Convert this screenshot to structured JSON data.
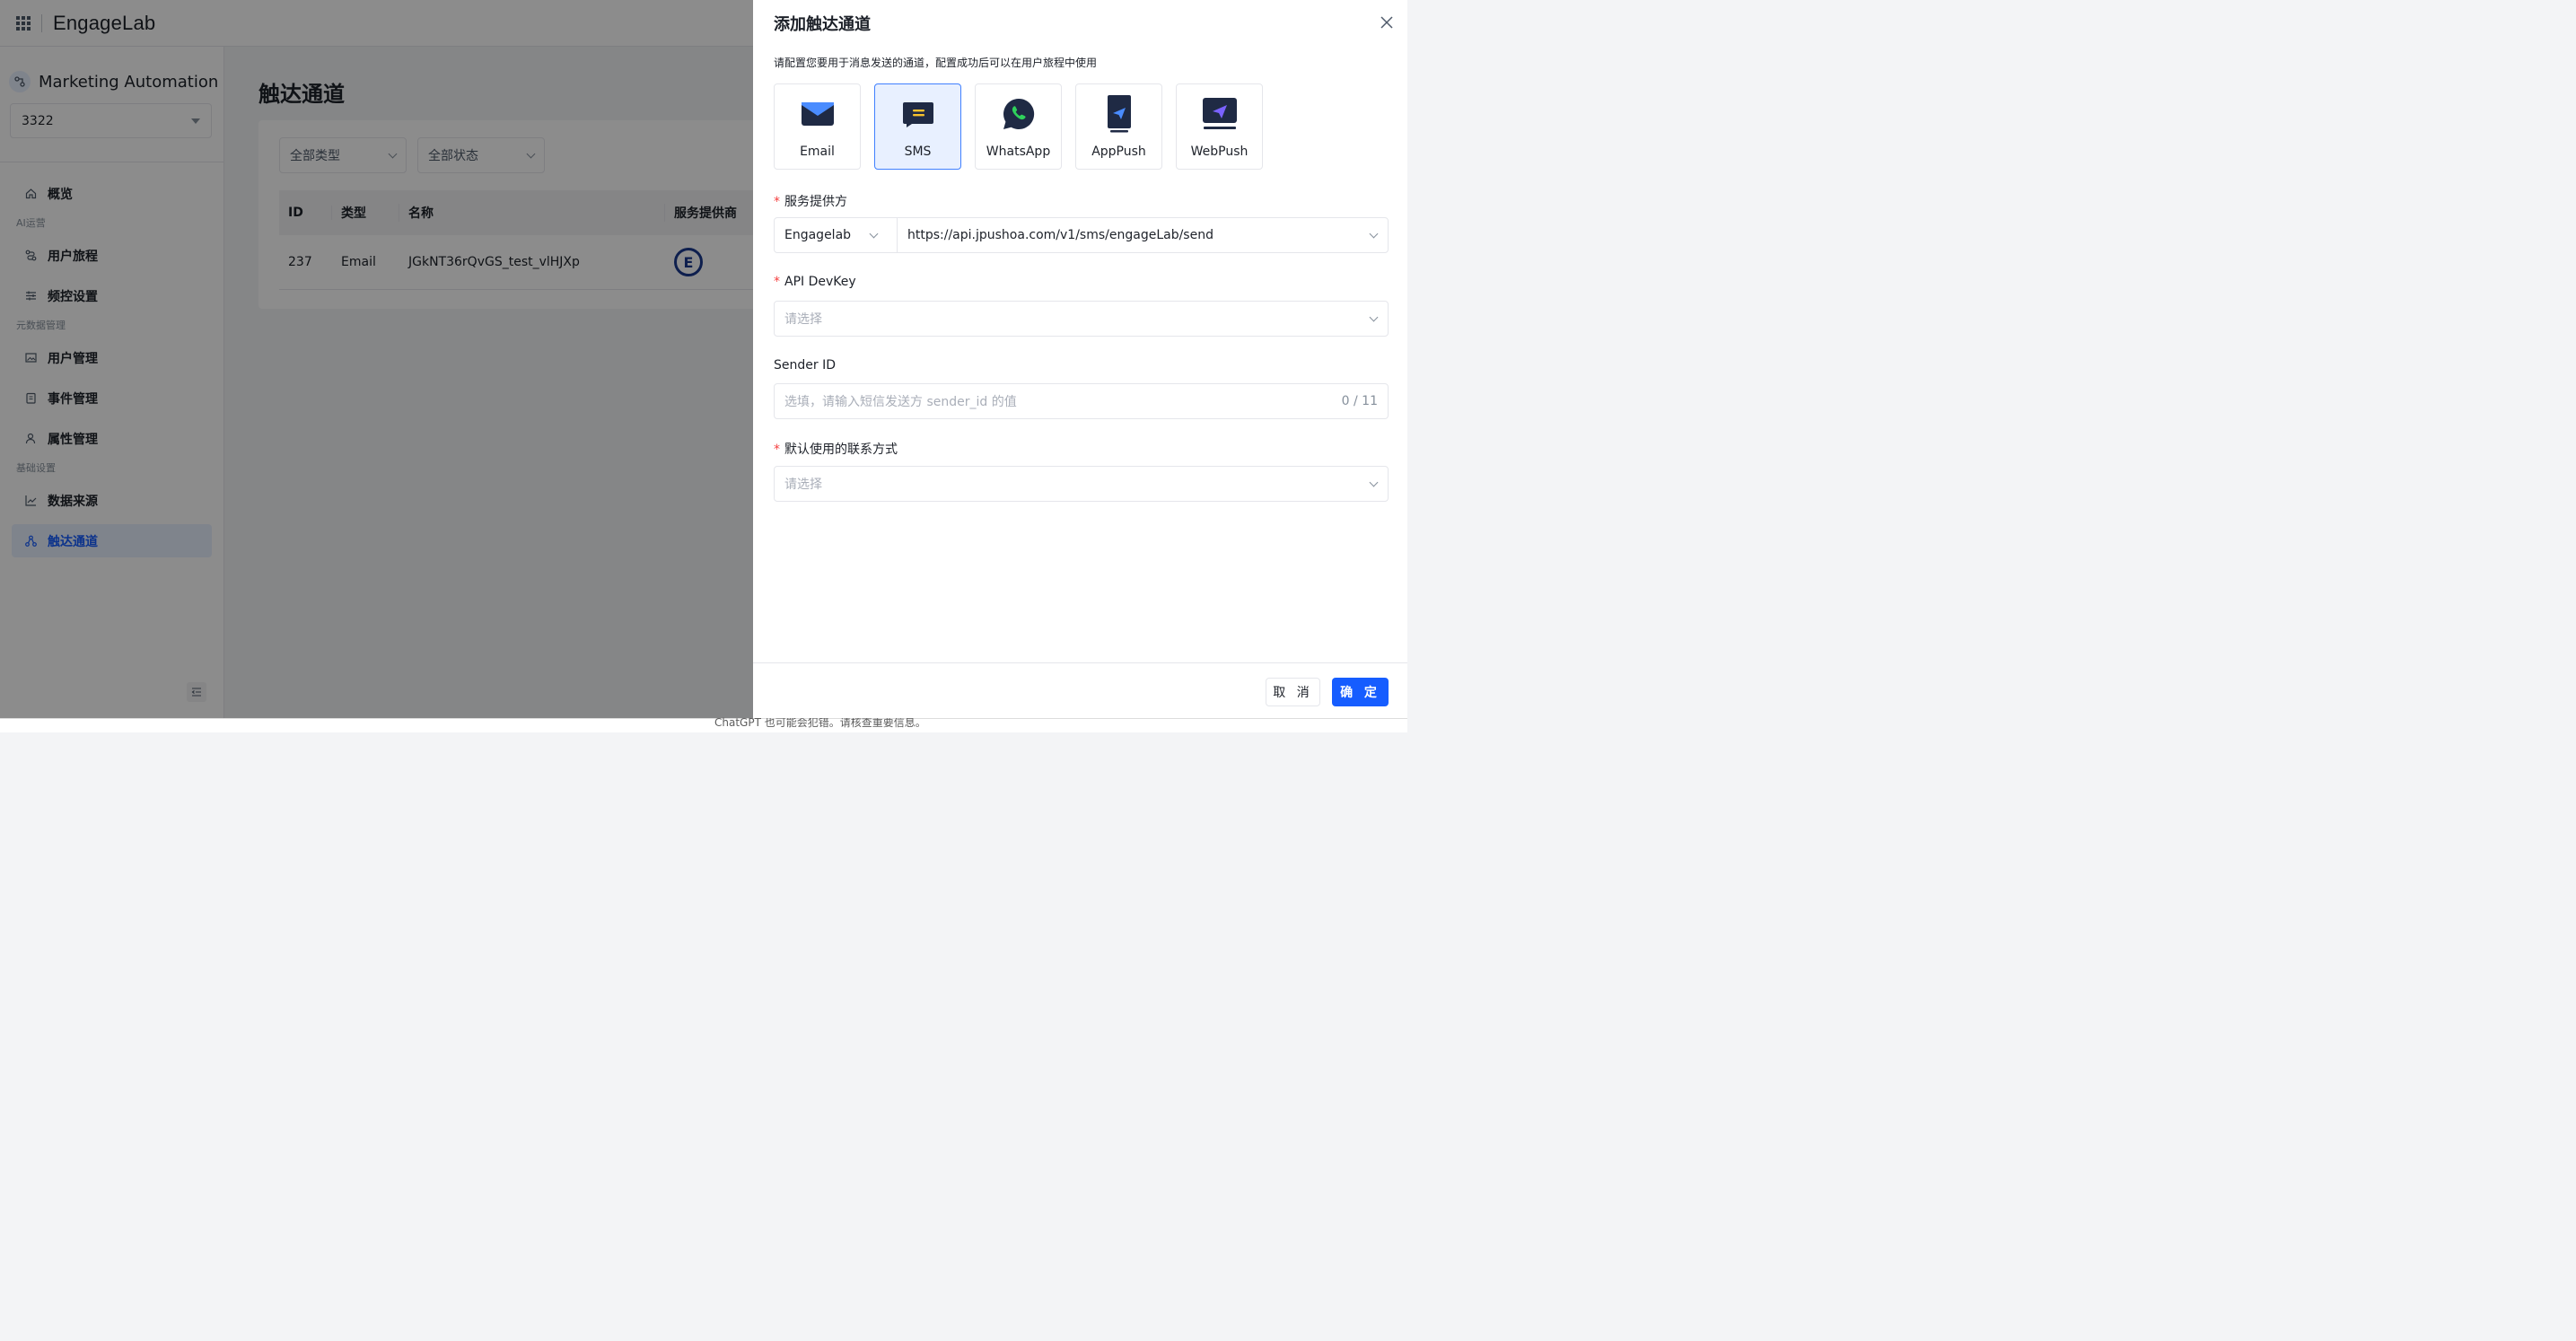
{
  "app": {
    "logo": "EngageLab",
    "product_title": "Marketing Automation",
    "app_selector_value": "3322"
  },
  "sidebar": {
    "items": [
      {
        "label": "概览",
        "icon": "home-icon"
      },
      {
        "group": "AI运营"
      },
      {
        "label": "用户旅程",
        "icon": "journey-icon"
      },
      {
        "label": "频控设置",
        "icon": "sliders-icon"
      },
      {
        "group": "元数据管理"
      },
      {
        "label": "用户管理",
        "icon": "image-icon"
      },
      {
        "label": "事件管理",
        "icon": "clipboard-icon"
      },
      {
        "label": "属性管理",
        "icon": "user-icon"
      },
      {
        "group": "基础设置"
      },
      {
        "label": "数据来源",
        "icon": "line-chart-icon"
      },
      {
        "label": "触达通道",
        "icon": "channel-icon",
        "active": true
      }
    ]
  },
  "page": {
    "title": "触达通道",
    "filters": {
      "type": "全部类型",
      "status": "全部状态"
    },
    "table": {
      "columns": [
        "ID",
        "类型",
        "名称",
        "服务提供商"
      ],
      "rows": [
        {
          "id": "237",
          "type": "Email",
          "name": "JGkNT36rQvGS_test_vlHJXp",
          "provider_logo": "E"
        }
      ]
    }
  },
  "footer_note": "ChatGPT 也可能会犯错。请核查重要信息。",
  "drawer": {
    "title": "添加触达通道",
    "description": "请配置您要用于消息发送的通道，配置成功后可以在用户旅程中使用",
    "channels": [
      {
        "label": "Email",
        "icon": "email-icon"
      },
      {
        "label": "SMS",
        "icon": "sms-icon",
        "selected": true
      },
      {
        "label": "WhatsApp",
        "icon": "whatsapp-icon"
      },
      {
        "label": "AppPush",
        "icon": "app-push-icon"
      },
      {
        "label": "WebPush",
        "icon": "web-push-icon"
      }
    ],
    "fields": {
      "provider": {
        "label": "服务提供方",
        "required": true,
        "vendor": "Engagelab",
        "endpoint": "https://api.jpushoa.com/v1/sms/engageLab/send"
      },
      "api_devkey": {
        "label": "API DevKey",
        "required": true,
        "placeholder": "请选择"
      },
      "sender_id": {
        "label": "Sender ID",
        "required": false,
        "placeholder": "选填，请输入短信发送方 sender_id 的值",
        "counter": "0 / 11"
      },
      "contact_method": {
        "label": "默认使用的联系方式",
        "required": true,
        "placeholder": "请选择"
      }
    },
    "buttons": {
      "cancel": "取 消",
      "confirm": "确 定"
    }
  },
  "colors": {
    "primary": "#165dff",
    "selected_tile_bg": "#e8f0ff",
    "required_mark": "#f53f3f"
  }
}
